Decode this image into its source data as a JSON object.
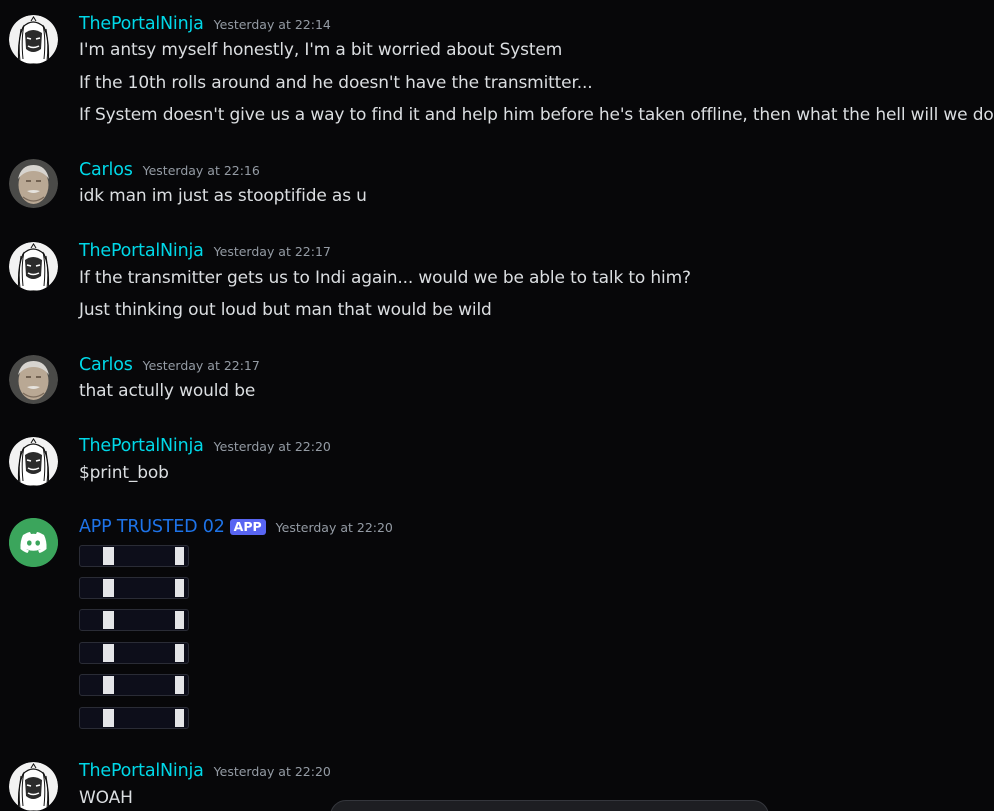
{
  "colors": {
    "background": "#070709",
    "username_cyan": "#00d8e8",
    "app_username_blue": "#1e73e8",
    "timestamp_gray": "#949ba4",
    "message_text": "#dbdee1",
    "app_badge_bg": "#5865f2",
    "discord_green": "#3ba55c"
  },
  "messages": [
    {
      "author": "ThePortalNinja",
      "timestamp": "Yesterday at 22:14",
      "avatar": "white-haired-ninja-avatar",
      "lines": [
        "I'm antsy myself honestly, I'm a bit worried about System",
        "If the 10th rolls around and he doesn't have the transmitter...",
        "If System doesn't give us a way to find it and help him before he's taken offline, then what the hell will we do"
      ]
    },
    {
      "author": "Carlos",
      "timestamp": "Yesterday at 22:16",
      "avatar": "old-man-avatar",
      "lines": [
        "idk man im just as stooptifide as u"
      ]
    },
    {
      "author": "ThePortalNinja",
      "timestamp": "Yesterday at 22:17",
      "avatar": "white-haired-ninja-avatar",
      "lines": [
        "If the transmitter gets us to Indi again... would we be able to talk to him?",
        "Just thinking out loud but man that would be wild"
      ]
    },
    {
      "author": "Carlos",
      "timestamp": "Yesterday at 22:17",
      "avatar": "old-man-avatar",
      "lines": [
        "that actully would be"
      ]
    },
    {
      "author": "ThePortalNinja",
      "timestamp": "Yesterday at 22:20",
      "avatar": "white-haired-ninja-avatar",
      "lines": [
        "$print_bob"
      ]
    },
    {
      "author": "APP TRUSTED 02",
      "badge": "APP",
      "timestamp": "Yesterday at 22:20",
      "avatar": "discord-logo-avatar",
      "lines": [],
      "embed_bars": 6
    },
    {
      "author": "ThePortalNinja",
      "timestamp": "Yesterday at 22:20",
      "avatar": "white-haired-ninja-avatar",
      "lines": [
        "WOAH"
      ]
    }
  ]
}
